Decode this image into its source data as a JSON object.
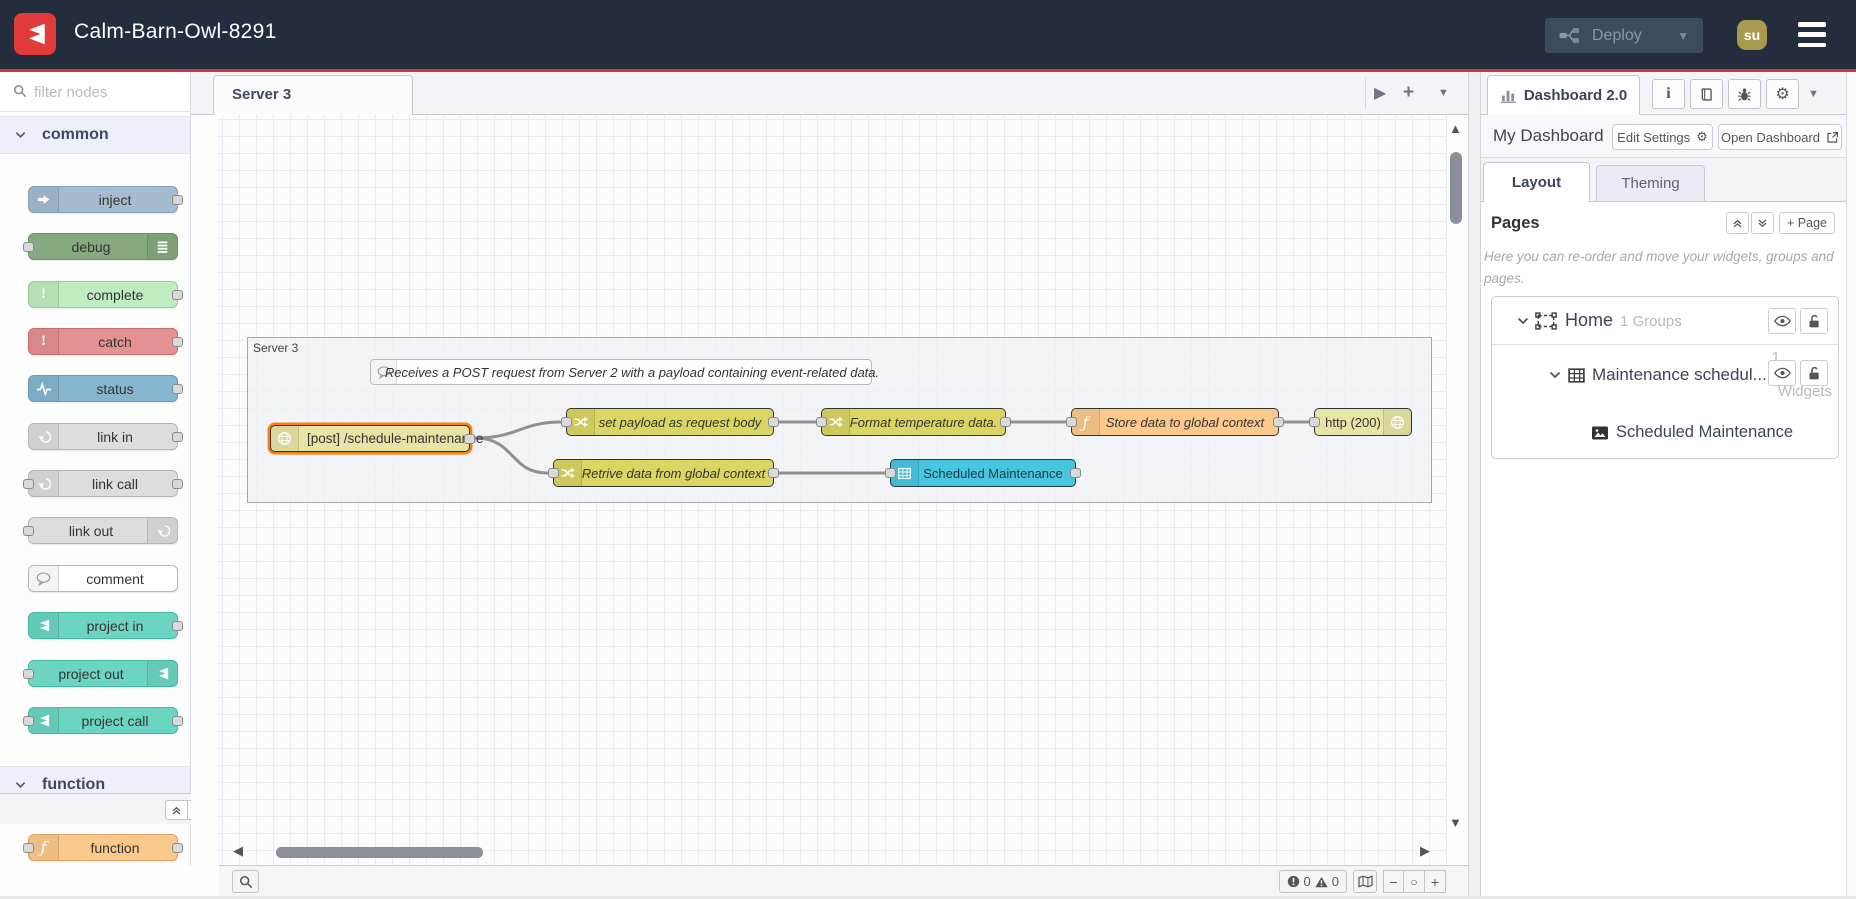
{
  "colors": {
    "header_bg": "#232d3d",
    "accent_red": "#cb3a3a",
    "logo_red": "#e23b3b",
    "avatar_bg": "#a89b4e",
    "selection_orange": "#ff7f0e",
    "node_inject": "#a6bbcf",
    "node_debug": "#87a980",
    "node_complete": "#c0edc0",
    "node_catch": "#e49191",
    "node_status": "#84b7cf",
    "node_link": "#dddddd",
    "node_project": "#6cd5c2",
    "node_function": "#fbc98c",
    "node_change": "#dbd563",
    "node_http": "#e7e4a7",
    "node_table": "#48c6e0"
  },
  "header": {
    "title": "Calm-Barn-Owl-8291",
    "deploy_label": "Deploy",
    "avatar_initials": "su"
  },
  "palette": {
    "filter_placeholder": "filter nodes",
    "sections": [
      {
        "label": "common",
        "nodes": [
          {
            "label": "inject"
          },
          {
            "label": "debug"
          },
          {
            "label": "complete"
          },
          {
            "label": "catch"
          },
          {
            "label": "status"
          },
          {
            "label": "link in"
          },
          {
            "label": "link call"
          },
          {
            "label": "link out"
          },
          {
            "label": "comment"
          },
          {
            "label": "project in"
          },
          {
            "label": "project out"
          },
          {
            "label": "project call"
          }
        ]
      },
      {
        "label": "function",
        "nodes": [
          {
            "label": "function"
          }
        ]
      }
    ]
  },
  "workspace": {
    "tab_label": "Server 3",
    "footer": {
      "errors": "0",
      "warnings": "0"
    }
  },
  "flow": {
    "group_label": "Server 3",
    "comment_text": "Receives a POST request from Server 2 with a payload containing event-related data.",
    "nodes": {
      "http_in": "[post] /schedule-maintenance",
      "set_payload": "set payload as request body",
      "format_temp": "Format temperature data.",
      "store_global": "Store data to global context",
      "http_response": "http (200)",
      "retrieve_global": "Retrive data from global context",
      "ui_table": "Scheduled Maintenance"
    }
  },
  "sidebar": {
    "tab_label": "Dashboard 2.0",
    "toolbar": {
      "name": "My Dashboard",
      "edit_settings": "Edit Settings",
      "open_dashboard": "Open Dashboard"
    },
    "tabs": {
      "layout": "Layout",
      "theming": "Theming"
    },
    "pages": {
      "title": "Pages",
      "add_button": "+ Page",
      "help": "Here you can re-order and move your widgets, groups and pages."
    },
    "tree": {
      "page_name": "Home",
      "page_meta": "1 Groups",
      "group_name": "Maintenance schedul...",
      "group_meta_count": "1",
      "group_meta_label": "Widgets",
      "widget_name": "Scheduled Maintenance"
    }
  }
}
